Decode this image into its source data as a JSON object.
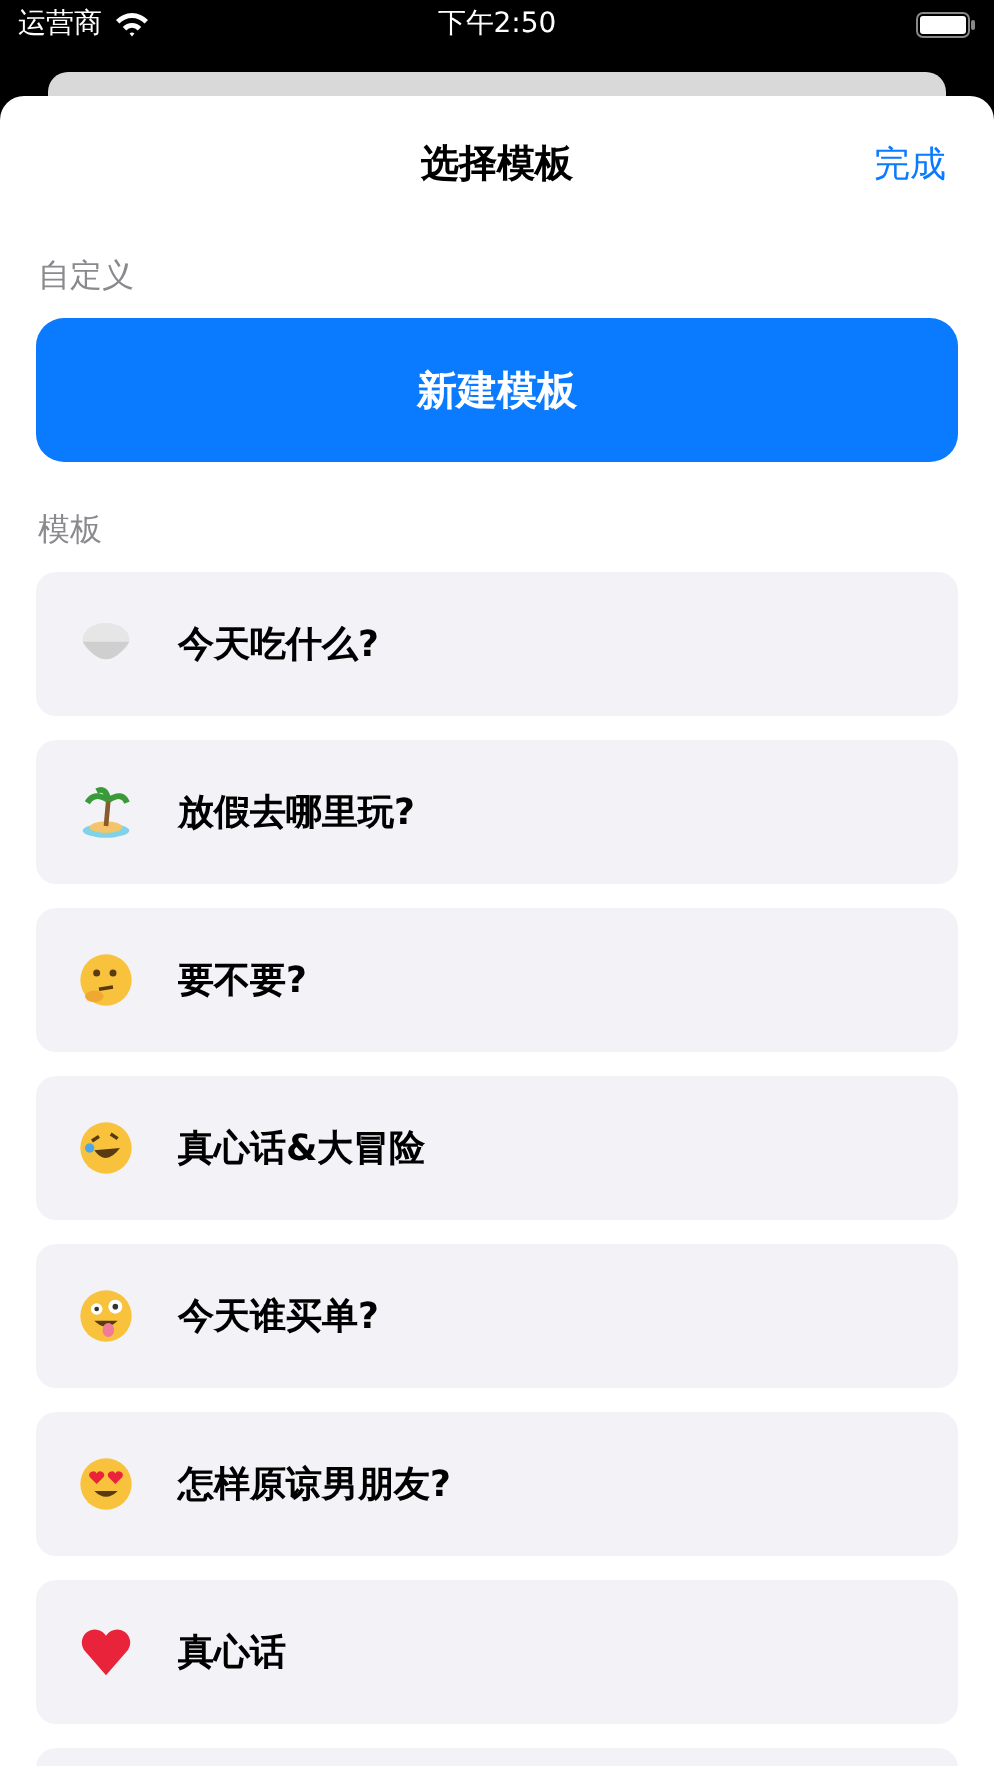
{
  "status_bar": {
    "carrier": "运营商",
    "time": "下午2:50"
  },
  "sheet": {
    "title": "选择模板",
    "done": "完成"
  },
  "custom_section": {
    "label": "自定义",
    "button": "新建模板"
  },
  "templates_section": {
    "label": "模板",
    "items": [
      {
        "title": "今天吃什么?"
      },
      {
        "title": "放假去哪里玩?"
      },
      {
        "title": "要不要?"
      },
      {
        "title": "真心话&大冒险"
      },
      {
        "title": "今天谁买单?"
      },
      {
        "title": "怎样原谅男朋友?"
      },
      {
        "title": "真心话"
      }
    ]
  }
}
